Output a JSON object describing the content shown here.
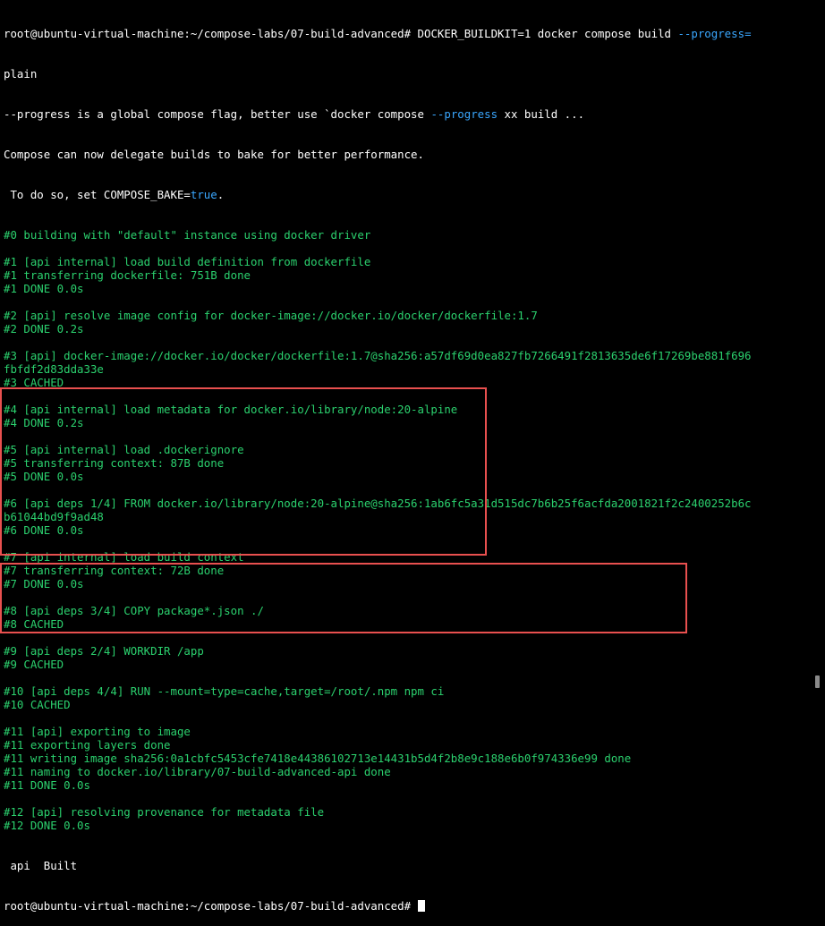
{
  "colors": {
    "background": "#000000",
    "text_white": "#ffffff",
    "text_green": "#2bd16e",
    "flag_blue": "#3aa7ff",
    "highlight_red": "#e8504f"
  },
  "prompt": "root@ubuntu-virtual-machine:~/compose-labs/07-build-advanced#",
  "command": {
    "prefix": " DOCKER_BUILDKIT=1 docker compose build ",
    "flag": "--progress=",
    "arg": "plain"
  },
  "warning": {
    "line1_a": "--progress is a global compose flag, better use `docker compose ",
    "line1_flag": "--progress",
    "line1_b": " xx build ...",
    "line2": "Compose can now delegate builds to bake for better performance.",
    "line3_a": " To do so, set COMPOSE_BAKE=",
    "line3_val": "true",
    "line3_b": "."
  },
  "build_lines": [
    "#0 building with \"default\" instance using docker driver",
    "",
    "#1 [api internal] load build definition from dockerfile",
    "#1 transferring dockerfile: 751B done",
    "#1 DONE 0.0s",
    "",
    "#2 [api] resolve image config for docker-image://docker.io/docker/dockerfile:1.7",
    "#2 DONE 0.2s",
    "",
    "#3 [api] docker-image://docker.io/docker/dockerfile:1.7@sha256:a57df69d0ea827fb7266491f2813635de6f17269be881f696",
    "fbfdf2d83dda33e",
    "#3 CACHED",
    "",
    "#4 [api internal] load metadata for docker.io/library/node:20-alpine",
    "#4 DONE 0.2s",
    "",
    "#5 [api internal] load .dockerignore",
    "#5 transferring context: 87B done",
    "#5 DONE 0.0s",
    "",
    "#6 [api deps 1/4] FROM docker.io/library/node:20-alpine@sha256:1ab6fc5a31d515dc7b6b25f6acfda2001821f2c2400252b6c",
    "b61044bd9f9ad48",
    "#6 DONE 0.0s",
    "",
    "#7 [api internal] load build context",
    "#7 transferring context: 72B done",
    "#7 DONE 0.0s",
    "",
    "#8 [api deps 3/4] COPY package*.json ./",
    "#8 CACHED",
    "",
    "#9 [api deps 2/4] WORKDIR /app",
    "#9 CACHED",
    "",
    "#10 [api deps 4/4] RUN --mount=type=cache,target=/root/.npm npm ci",
    "#10 CACHED",
    "",
    "#11 [api] exporting to image",
    "#11 exporting layers done",
    "#11 writing image sha256:0a1cbfc5453cfe7418e44386102713e14431b5d4f2b8e9c188e6b0f974336e99 done",
    "#11 naming to docker.io/library/07-build-advanced-api done",
    "#11 DONE 0.0s",
    "",
    "#12 [api] resolving provenance for metadata file",
    "#12 DONE 0.0s"
  ],
  "result_line": " api  Built",
  "final_prompt": "root@ubuntu-virtual-machine:~/compose-labs/07-build-advanced#"
}
